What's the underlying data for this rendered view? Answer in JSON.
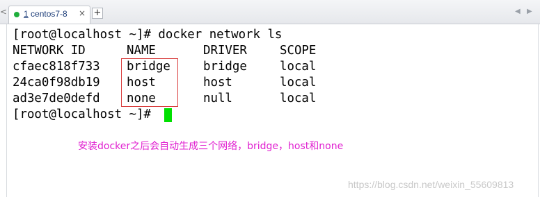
{
  "tabbar": {
    "nav_left": "<",
    "active_tab": {
      "number": "1",
      "title": "centos7-8",
      "close": "×"
    },
    "add_tab": "+",
    "nav_prev": "◀",
    "nav_next": "▶"
  },
  "terminal": {
    "lines": [
      {
        "text": "[root@localhost ~]# docker network ls"
      },
      {
        "cols": [
          "NETWORK ID",
          "NAME",
          "DRIVER",
          "SCOPE"
        ]
      },
      {
        "cols": [
          "cfaec818f733",
          "bridge",
          "bridge",
          "local"
        ]
      },
      {
        "cols": [
          "24ca0f98db19",
          "host",
          "host",
          "local"
        ]
      },
      {
        "cols": [
          "ad3e7de0defd",
          "none",
          "null",
          "local"
        ]
      },
      {
        "text": "[root@localhost ~]# "
      }
    ],
    "cursor_color": "#00e000"
  },
  "annotation": {
    "text": "安装docker之后会自动生成三个网络，bridge，host和none",
    "color": "#e020d0",
    "box_color": "#d83a3a"
  },
  "watermark": "https://blog.csdn.net/weixin_55609813"
}
